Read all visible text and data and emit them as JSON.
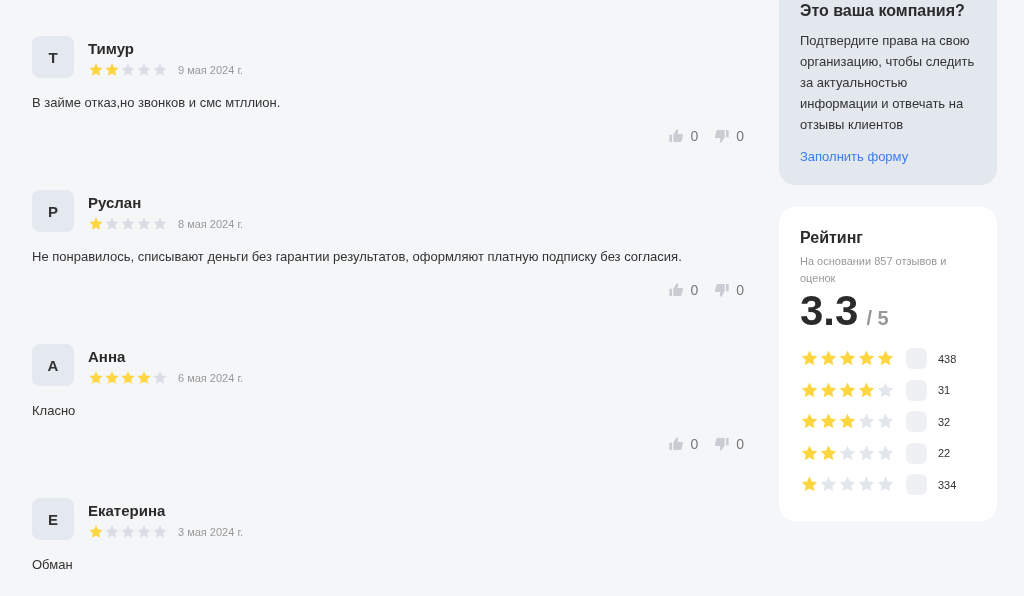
{
  "reviews": [
    {
      "initial": "Т",
      "name": "Тимур",
      "stars": 2,
      "date": "9 мая 2024 г.",
      "text": "В займе отказ,но звонков и смс мтллион.",
      "likes": "0",
      "dislikes": "0"
    },
    {
      "initial": "Р",
      "name": "Руслан",
      "stars": 1,
      "date": "8 мая 2024 г.",
      "text": "Не понравилось, списывают деньги без гарантии результатов, оформляют платную подписку без согласия.",
      "likes": "0",
      "dislikes": "0"
    },
    {
      "initial": "А",
      "name": "Анна",
      "stars": 4,
      "date": "6 мая 2024 г.",
      "text": "Класно",
      "likes": "0",
      "dislikes": "0"
    },
    {
      "initial": "Е",
      "name": "Екатерина",
      "stars": 1,
      "date": "3 мая 2024 г.",
      "text": "Обман"
    }
  ],
  "claim_card": {
    "title": "Это ваша компания?",
    "text": "Подтвердите права на свою организацию, чтобы следить за актуальностью информации и отвечать на отзывы клиентов",
    "link": "Заполнить форму"
  },
  "rating_card": {
    "title": "Рейтинг",
    "subtitle": "На основании 857 отзывов и оценок",
    "score": "3.3",
    "out_of": "/ 5",
    "breakdown": [
      {
        "stars": 5,
        "count": "438"
      },
      {
        "stars": 4,
        "count": "31"
      },
      {
        "stars": 3,
        "count": "32"
      },
      {
        "stars": 2,
        "count": "22"
      },
      {
        "stars": 1,
        "count": "334"
      }
    ]
  }
}
